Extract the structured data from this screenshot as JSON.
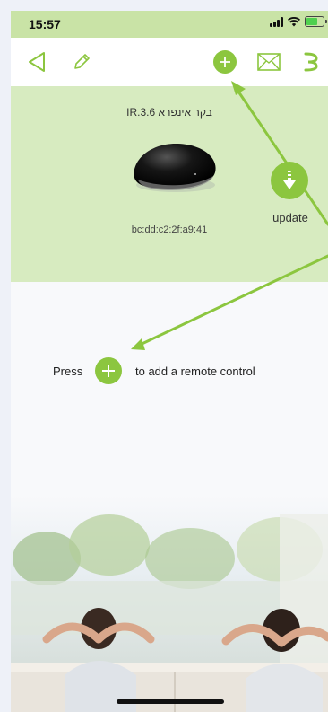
{
  "status_bar": {
    "time": "15:57"
  },
  "toolbar": {
    "icons": [
      "back-icon",
      "edit-icon",
      "add-icon",
      "mail-icon",
      "menu-icon"
    ]
  },
  "device": {
    "name": "IR.3.6 בקר אינפרא",
    "mac": "bc:dd:c2:2f:a9:41",
    "update_label": "update"
  },
  "hint": {
    "prefix": "Press",
    "suffix": "to add a remote control"
  },
  "colors": {
    "accent": "#8cc63f",
    "card_bg": "#d7ebc0",
    "status_bg": "#c9e3a6",
    "arrow": "#8cc63f"
  }
}
